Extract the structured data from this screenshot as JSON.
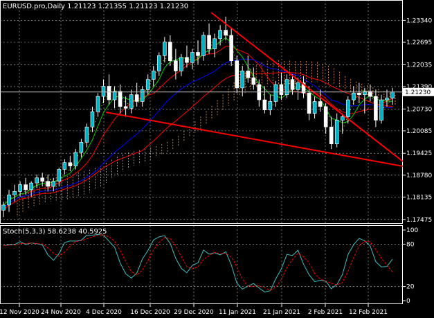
{
  "main": {
    "header": "EURUSD.pro,Daily  1.21123  1.21355  1.21123  1.21230",
    "price_label": "1.21230",
    "price_value": 1.2123,
    "price_ticks": [
      "1.23340",
      "1.22695",
      "1.22035",
      "1.21390",
      "1.20730",
      "1.20085",
      "1.19425",
      "1.18780",
      "1.18135",
      "1.17475"
    ],
    "price_range": [
      1.1745,
      1.2345
    ]
  },
  "stoch": {
    "header": "Stoch(5,3,3) 58.6238 40.5925",
    "level_ticks": [
      "100",
      "80",
      "20",
      "0"
    ],
    "k_value": 58.6238,
    "d_value": 40.5925
  },
  "time_axis": {
    "labels": [
      "12 Nov 2020",
      "24 Nov 2020",
      "4 Dec 2020",
      "16 Dec 2020",
      "29 Dec 2020",
      "11 Jan 2021",
      "21 Jan 2021",
      "2 Feb 2021",
      "12 Feb 2021"
    ]
  },
  "colors": {
    "background": "#000000",
    "grid": "#c0c0c0",
    "bull_candle": "#ffffff",
    "bear_candle": "#ffffff",
    "bull_body": "#00b4c8",
    "bear_body": "#ffffff",
    "trendline": "#ff0000",
    "ma_red": "#ff0000",
    "ma_blue": "#0000ff",
    "ma_green": "#00cc00",
    "ma_lime": "#7fff00",
    "cloud": "#f4a460",
    "stoch_main": "#40c0c0",
    "stoch_signal": "#ff0000"
  },
  "candles": [
    [
      1.1775,
      1.18,
      1.1755,
      1.179
    ],
    [
      1.179,
      1.1835,
      1.177,
      1.182
    ],
    [
      1.182,
      1.185,
      1.18,
      1.183
    ],
    [
      1.183,
      1.186,
      1.1815,
      1.185
    ],
    [
      1.185,
      1.187,
      1.182,
      1.1835
    ],
    [
      1.1835,
      1.186,
      1.1815,
      1.1855
    ],
    [
      1.1855,
      1.188,
      1.184,
      1.187
    ],
    [
      1.187,
      1.1885,
      1.1845,
      1.186
    ],
    [
      1.186,
      1.188,
      1.183,
      1.1845
    ],
    [
      1.1845,
      1.187,
      1.183,
      1.186
    ],
    [
      1.186,
      1.19,
      1.1845,
      1.1895
    ],
    [
      1.1895,
      1.1925,
      1.188,
      1.1915
    ],
    [
      1.1915,
      1.1935,
      1.189,
      1.1905
    ],
    [
      1.1905,
      1.1955,
      1.1895,
      1.1945
    ],
    [
      1.1945,
      1.1985,
      1.193,
      1.1975
    ],
    [
      1.1975,
      1.203,
      1.196,
      1.202
    ],
    [
      1.202,
      1.208,
      1.2005,
      1.2065
    ],
    [
      1.2065,
      1.212,
      1.205,
      1.211
    ],
    [
      1.211,
      1.216,
      1.209,
      1.214
    ],
    [
      1.214,
      1.2175,
      1.2085,
      1.21
    ],
    [
      1.21,
      1.214,
      1.2075,
      1.2125
    ],
    [
      1.2125,
      1.2145,
      1.206,
      1.208
    ],
    [
      1.208,
      1.211,
      1.205,
      1.2075
    ],
    [
      1.2075,
      1.213,
      1.206,
      1.2115
    ],
    [
      1.2115,
      1.215,
      1.208,
      1.2095
    ],
    [
      1.2095,
      1.214,
      1.208,
      1.213
    ],
    [
      1.213,
      1.2175,
      1.2115,
      1.216
    ],
    [
      1.216,
      1.22,
      1.214,
      1.2185
    ],
    [
      1.2185,
      1.224,
      1.217,
      1.223
    ],
    [
      1.223,
      1.2285,
      1.221,
      1.227
    ],
    [
      1.227,
      1.229,
      1.22,
      1.2215
    ],
    [
      1.2215,
      1.225,
      1.216,
      1.2185
    ],
    [
      1.2185,
      1.2235,
      1.217,
      1.2225
    ],
    [
      1.2225,
      1.226,
      1.2195,
      1.221
    ],
    [
      1.221,
      1.225,
      1.219,
      1.224
    ],
    [
      1.224,
      1.2275,
      1.2205,
      1.223
    ],
    [
      1.223,
      1.23,
      1.2215,
      1.229
    ],
    [
      1.229,
      1.2325,
      1.2235,
      1.225
    ],
    [
      1.225,
      1.2295,
      1.2225,
      1.228
    ],
    [
      1.228,
      1.232,
      1.226,
      1.2305
    ],
    [
      1.2305,
      1.2345,
      1.2275,
      1.229
    ],
    [
      1.229,
      1.231,
      1.22,
      1.2215
    ],
    [
      1.2215,
      1.223,
      1.212,
      1.2135
    ],
    [
      1.2135,
      1.22,
      1.211,
      1.2185
    ],
    [
      1.2185,
      1.223,
      1.215,
      1.2165
    ],
    [
      1.2165,
      1.2195,
      1.213,
      1.2145
    ],
    [
      1.2145,
      1.216,
      1.208,
      1.21
    ],
    [
      1.21,
      1.214,
      1.206,
      1.207
    ],
    [
      1.207,
      1.2115,
      1.2055,
      1.2095
    ],
    [
      1.2095,
      1.2155,
      1.208,
      1.2145
    ],
    [
      1.2145,
      1.218,
      1.21,
      1.2115
    ],
    [
      1.2115,
      1.2175,
      1.2105,
      1.216
    ],
    [
      1.216,
      1.2175,
      1.2115,
      1.213
    ],
    [
      1.213,
      1.2165,
      1.21,
      1.215
    ],
    [
      1.215,
      1.217,
      1.2105,
      1.212
    ],
    [
      1.212,
      1.214,
      1.204,
      1.206
    ],
    [
      1.206,
      1.211,
      1.2045,
      1.2095
    ],
    [
      1.2095,
      1.213,
      1.2065,
      1.208
    ],
    [
      1.208,
      1.209,
      1.2,
      1.202
    ],
    [
      1.202,
      1.205,
      1.1955,
      1.197
    ],
    [
      1.197,
      1.206,
      1.196,
      1.204
    ],
    [
      1.204,
      1.206,
      1.2,
      1.205
    ],
    [
      1.205,
      1.211,
      1.203,
      1.21
    ],
    [
      1.21,
      1.214,
      1.2085,
      1.212
    ],
    [
      1.212,
      1.215,
      1.209,
      1.2115
    ],
    [
      1.2115,
      1.2135,
      1.206,
      1.2125
    ],
    [
      1.2125,
      1.2145,
      1.2095,
      1.211
    ],
    [
      1.211,
      1.213,
      1.202,
      1.204
    ],
    [
      1.204,
      1.2115,
      1.203,
      1.21
    ],
    [
      1.21,
      1.213,
      1.208,
      1.2105
    ],
    [
      1.2105,
      1.2135,
      1.2085,
      1.2123
    ]
  ]
}
